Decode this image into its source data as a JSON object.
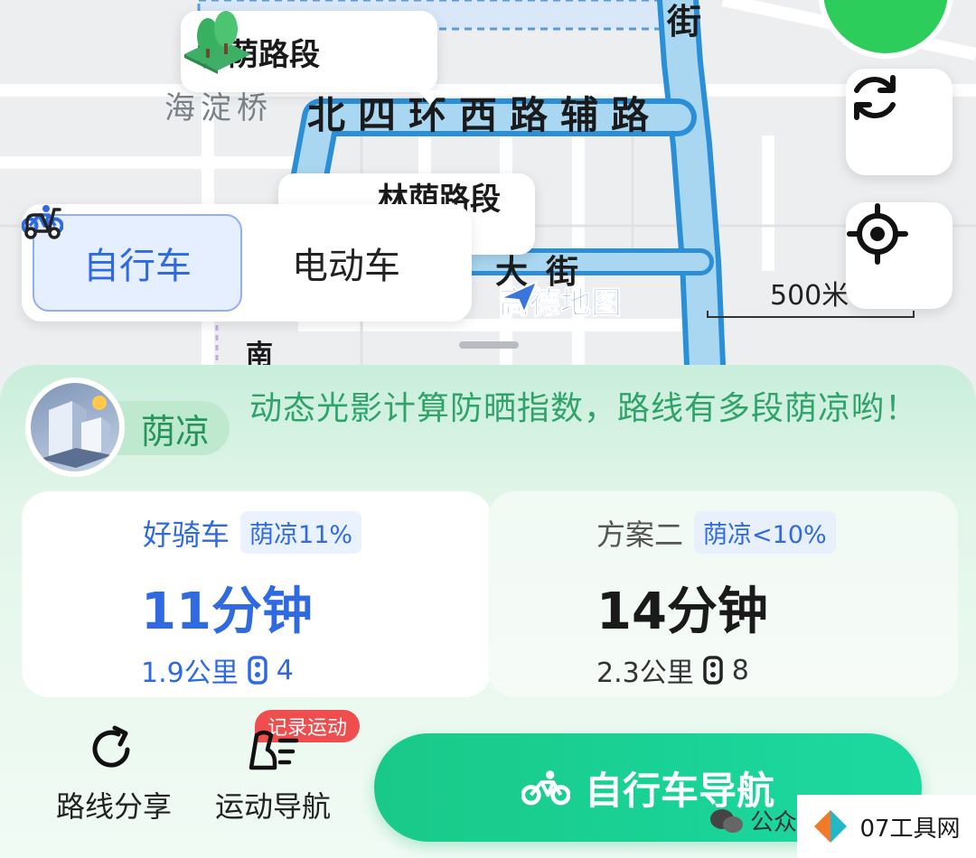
{
  "map": {
    "shade_segment_label_1": "林荫路段",
    "shade_segment_label_2": "林荫路段",
    "bridge_label": "海淀桥",
    "main_road_label": "北四环西路辅路",
    "street_vertical_1": "街",
    "street_label_2": "大街",
    "south_label": "南",
    "scale_label": "500米",
    "map_logo_text": "高德地图"
  },
  "map_controls": {
    "refresh_icon": "refresh-icon",
    "locate_icon": "locate-icon"
  },
  "mode_switch": {
    "bike_label": "自行车",
    "ebike_label": "电动车",
    "active": "bike"
  },
  "shade_info": {
    "tag": "荫凉",
    "description": "动态光影计算防晒指数，路线有多段荫凉哟！"
  },
  "routes": [
    {
      "name": "好骑车",
      "shade_tag": "荫凉11%",
      "duration": "11分钟",
      "distance": "1.9公里",
      "lights_count": "4",
      "selected": true
    },
    {
      "name": "方案二",
      "shade_tag": "荫凉<10%",
      "duration": "14分钟",
      "distance": "2.3公里",
      "lights_count": "8",
      "selected": false
    }
  ],
  "actions": {
    "share_label": "路线分享",
    "sport_nav_label": "运动导航",
    "record_badge": "记录运动",
    "nav_button_label": "自行车导航"
  },
  "watermark": {
    "source_text": "公众",
    "site_text": "07工具网"
  },
  "colors": {
    "accent_blue": "#2f6ae0",
    "shade_green": "#2fa36a",
    "nav_green": "#19c989",
    "route_line": "#2b8fd8",
    "badge_red": "#f04e4e"
  }
}
